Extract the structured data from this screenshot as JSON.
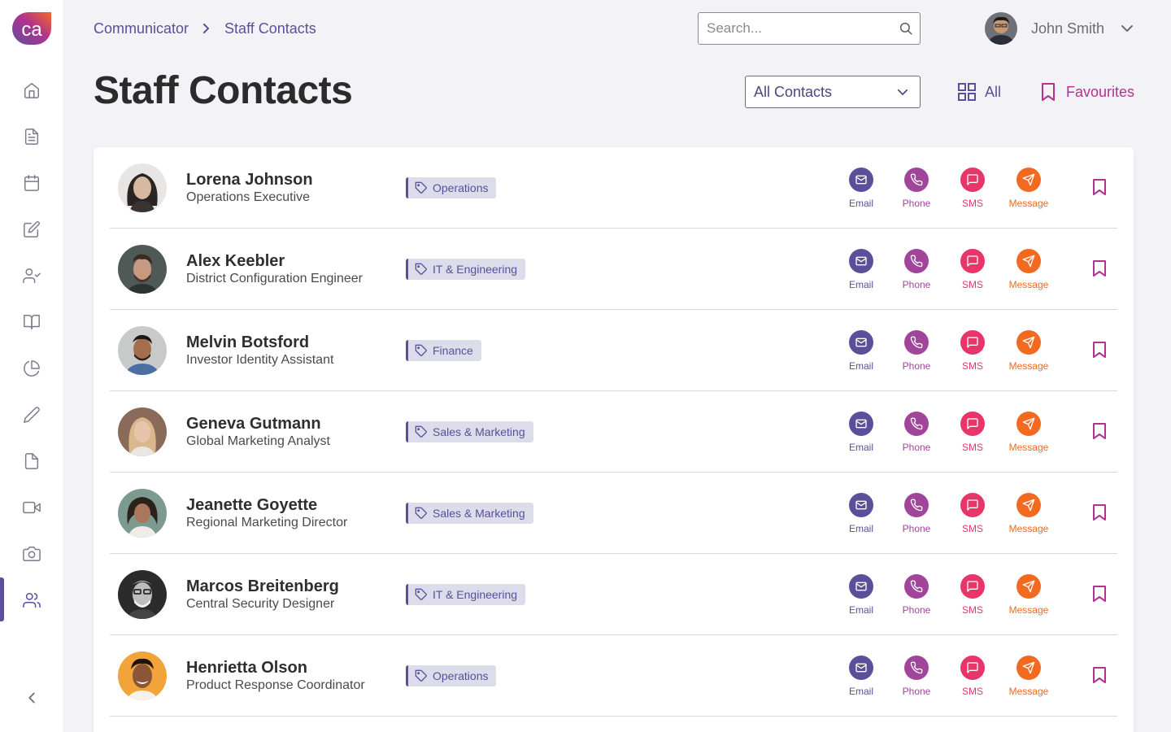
{
  "app": {
    "logo_text": "ca"
  },
  "breadcrumb": {
    "items": [
      "Communicator",
      "Staff Contacts"
    ]
  },
  "search": {
    "placeholder": "Search..."
  },
  "user": {
    "name": "John Smith"
  },
  "page": {
    "title": "Staff Contacts"
  },
  "filter": {
    "selected": "All Contacts"
  },
  "views": {
    "all_label": "All",
    "favourites_label": "Favourites"
  },
  "sidebar": {
    "icons": [
      "home-icon",
      "document-icon",
      "calendar-icon",
      "edit-icon",
      "user-check-icon",
      "book-icon",
      "pie-chart-icon",
      "pencil-icon",
      "file-icon",
      "video-icon",
      "camera-icon",
      "users-icon"
    ],
    "active": "users-icon"
  },
  "actions": {
    "email": "Email",
    "phone": "Phone",
    "sms": "SMS",
    "message": "Message"
  },
  "colors": {
    "brand": "#5b4f9a",
    "email": "#5b4f9a",
    "phone": "#a0459a",
    "sms": "#e8356a",
    "message": "#f26a21",
    "favourite": "#b2328f"
  },
  "contacts": [
    {
      "name": "Lorena Johnson",
      "role": "Operations Executive",
      "department": "Operations"
    },
    {
      "name": "Alex Keebler",
      "role": "District Configuration Engineer",
      "department": "IT & Engineering"
    },
    {
      "name": "Melvin Botsford",
      "role": "Investor Identity Assistant",
      "department": "Finance"
    },
    {
      "name": "Geneva Gutmann",
      "role": "Global Marketing Analyst",
      "department": "Sales & Marketing"
    },
    {
      "name": "Jeanette Goyette",
      "role": "Regional Marketing Director",
      "department": "Sales & Marketing"
    },
    {
      "name": "Marcos Breitenberg",
      "role": "Central Security Designer",
      "department": "IT & Engineering"
    },
    {
      "name": "Henrietta Olson",
      "role": "Product Response Coordinator",
      "department": "Operations"
    }
  ]
}
